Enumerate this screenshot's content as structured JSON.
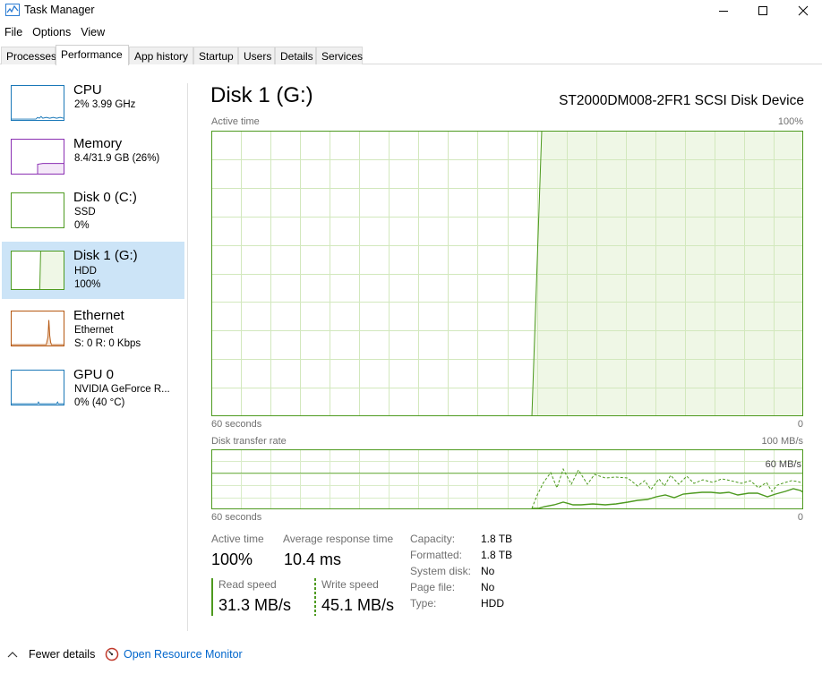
{
  "window": {
    "title": "Task Manager",
    "minimize_icon": "minimize-icon",
    "maximize_icon": "maximize-icon",
    "close_icon": "close-icon"
  },
  "menu": [
    "File",
    "Options",
    "View"
  ],
  "tabs": [
    "Processes",
    "Performance",
    "App history",
    "Startup",
    "Users",
    "Details",
    "Services"
  ],
  "active_tab": "Performance",
  "sidebar": {
    "items": [
      {
        "title": "CPU",
        "line1": "2%  3.99 GHz",
        "line2": "",
        "color": "#1a78b8"
      },
      {
        "title": "Memory",
        "line1": "8.4/31.9 GB (26%)",
        "line2": "",
        "color": "#8b2fb3"
      },
      {
        "title": "Disk 0 (C:)",
        "line1": "SSD",
        "line2": "0%",
        "color": "#4d9a1f"
      },
      {
        "title": "Disk 1 (G:)",
        "line1": "HDD",
        "line2": "100%",
        "color": "#4d9a1f"
      },
      {
        "title": "Ethernet",
        "line1": "Ethernet",
        "line2": "S: 0  R: 0 Kbps",
        "color": "#b5560f"
      },
      {
        "title": "GPU 0",
        "line1": "NVIDIA GeForce R...",
        "line2": "0% (40 °C)",
        "color": "#1a78b8"
      }
    ]
  },
  "main": {
    "title": "Disk 1 (G:)",
    "device": "ST2000DM008-2FR1 SCSI Disk Device",
    "active_time_label": "Active time",
    "active_time_max": "100%",
    "axis_left": "60 seconds",
    "axis_right": "0",
    "transfer_label": "Disk transfer rate",
    "transfer_max": "100 MB/s",
    "transfer_mid": "60 MB/s",
    "axis2_left": "60 seconds",
    "axis2_right": "0"
  },
  "stats": {
    "active_time_label": "Active time",
    "active_time_value": "100%",
    "avg_response_label": "Average response time",
    "avg_response_value": "10.4 ms",
    "read_label": "Read speed",
    "read_value": "31.3 MB/s",
    "write_label": "Write speed",
    "write_value": "45.1 MB/s"
  },
  "properties": [
    {
      "key": "Capacity:",
      "value": "1.8 TB"
    },
    {
      "key": "Formatted:",
      "value": "1.8 TB"
    },
    {
      "key": "System disk:",
      "value": "No"
    },
    {
      "key": "Page file:",
      "value": "No"
    },
    {
      "key": "Type:",
      "value": "HDD"
    }
  ],
  "footer": {
    "fewer_details": "Fewer details",
    "open_monitor": "Open Resource Monitor"
  },
  "colors": {
    "disk_green": "#4d9a1f",
    "disk_fill": "#eff7e6",
    "grid": "#d9ecc8",
    "selected": "#cce4f7",
    "link": "#0066cc"
  }
}
